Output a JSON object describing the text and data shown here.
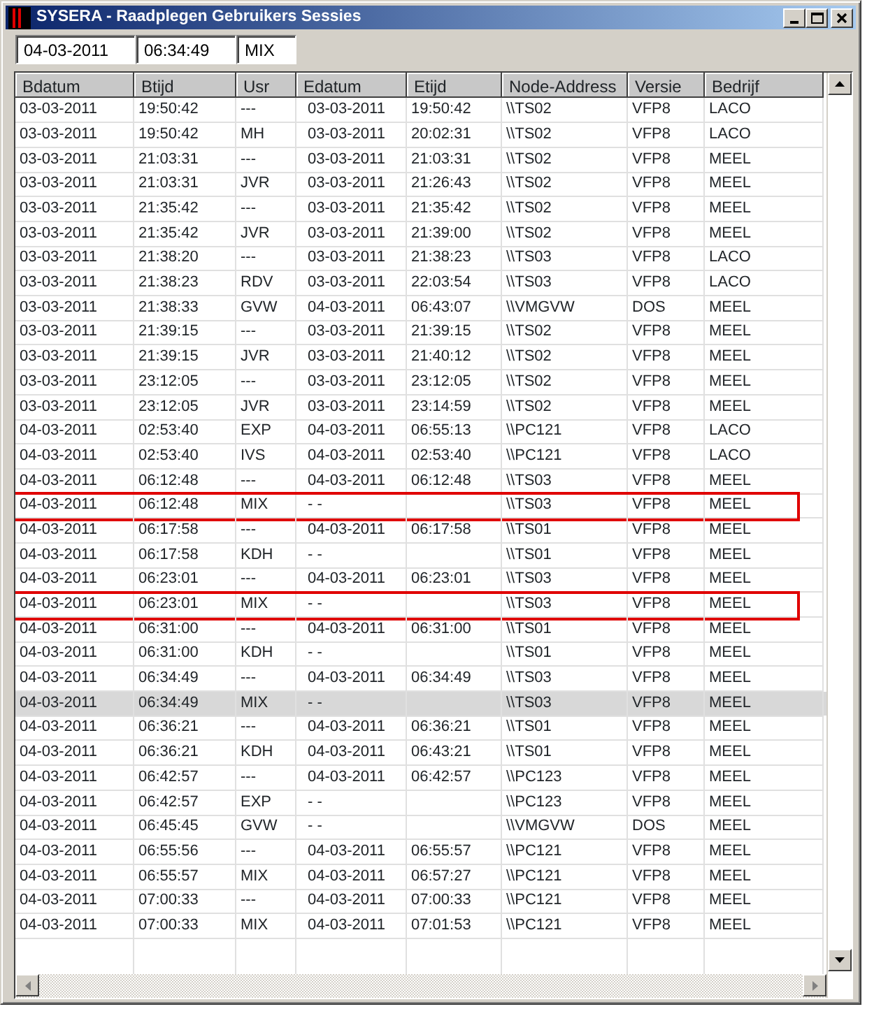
{
  "window": {
    "title": "SYSERA - Raadplegen Gebruikers Sessies"
  },
  "fields": [
    {
      "value": "04-03-2011"
    },
    {
      "value": "06:34:49"
    },
    {
      "value": "MIX"
    }
  ],
  "table": {
    "columns": [
      {
        "label": "Bdatum"
      },
      {
        "label": "Btijd"
      },
      {
        "label": "Usr"
      },
      {
        "label": "Edatum"
      },
      {
        "label": "Etijd"
      },
      {
        "label": "Node-Address"
      },
      {
        "label": "Versie"
      },
      {
        "label": "Bedrijf"
      }
    ],
    "rows": [
      {
        "bdatum": "03-03-2011",
        "btijd": "19:50:42",
        "usr": "---",
        "edatum": "03-03-2011",
        "etijd": "19:50:42",
        "node_address": "\\\\TS02",
        "versie": "VFP8",
        "bedrijf": "LACO",
        "selected": false,
        "marked": false
      },
      {
        "bdatum": "03-03-2011",
        "btijd": "19:50:42",
        "usr": "MH",
        "edatum": "03-03-2011",
        "etijd": "20:02:31",
        "node_address": "\\\\TS02",
        "versie": "VFP8",
        "bedrijf": "LACO",
        "selected": false,
        "marked": false
      },
      {
        "bdatum": "03-03-2011",
        "btijd": "21:03:31",
        "usr": "---",
        "edatum": "03-03-2011",
        "etijd": "21:03:31",
        "node_address": "\\\\TS02",
        "versie": "VFP8",
        "bedrijf": "MEEL",
        "selected": false,
        "marked": false
      },
      {
        "bdatum": "03-03-2011",
        "btijd": "21:03:31",
        "usr": "JVR",
        "edatum": "03-03-2011",
        "etijd": "21:26:43",
        "node_address": "\\\\TS02",
        "versie": "VFP8",
        "bedrijf": "MEEL",
        "selected": false,
        "marked": false
      },
      {
        "bdatum": "03-03-2011",
        "btijd": "21:35:42",
        "usr": "---",
        "edatum": "03-03-2011",
        "etijd": "21:35:42",
        "node_address": "\\\\TS02",
        "versie": "VFP8",
        "bedrijf": "MEEL",
        "selected": false,
        "marked": false
      },
      {
        "bdatum": "03-03-2011",
        "btijd": "21:35:42",
        "usr": "JVR",
        "edatum": "03-03-2011",
        "etijd": "21:39:00",
        "node_address": "\\\\TS02",
        "versie": "VFP8",
        "bedrijf": "MEEL",
        "selected": false,
        "marked": false
      },
      {
        "bdatum": "03-03-2011",
        "btijd": "21:38:20",
        "usr": "---",
        "edatum": "03-03-2011",
        "etijd": "21:38:23",
        "node_address": "\\\\TS03",
        "versie": "VFP8",
        "bedrijf": "LACO",
        "selected": false,
        "marked": false
      },
      {
        "bdatum": "03-03-2011",
        "btijd": "21:38:23",
        "usr": "RDV",
        "edatum": "03-03-2011",
        "etijd": "22:03:54",
        "node_address": "\\\\TS03",
        "versie": "VFP8",
        "bedrijf": "LACO",
        "selected": false,
        "marked": false
      },
      {
        "bdatum": "03-03-2011",
        "btijd": "21:38:33",
        "usr": "GVW",
        "edatum": "04-03-2011",
        "etijd": "06:43:07",
        "node_address": "\\\\VMGVW",
        "versie": "DOS",
        "bedrijf": "MEEL",
        "selected": false,
        "marked": false
      },
      {
        "bdatum": "03-03-2011",
        "btijd": "21:39:15",
        "usr": "---",
        "edatum": "03-03-2011",
        "etijd": "21:39:15",
        "node_address": "\\\\TS02",
        "versie": "VFP8",
        "bedrijf": "MEEL",
        "selected": false,
        "marked": false
      },
      {
        "bdatum": "03-03-2011",
        "btijd": "21:39:15",
        "usr": "JVR",
        "edatum": "03-03-2011",
        "etijd": "21:40:12",
        "node_address": "\\\\TS02",
        "versie": "VFP8",
        "bedrijf": "MEEL",
        "selected": false,
        "marked": false
      },
      {
        "bdatum": "03-03-2011",
        "btijd": "23:12:05",
        "usr": "---",
        "edatum": "03-03-2011",
        "etijd": "23:12:05",
        "node_address": "\\\\TS02",
        "versie": "VFP8",
        "bedrijf": "MEEL",
        "selected": false,
        "marked": false
      },
      {
        "bdatum": "03-03-2011",
        "btijd": "23:12:05",
        "usr": "JVR",
        "edatum": "03-03-2011",
        "etijd": "23:14:59",
        "node_address": "\\\\TS02",
        "versie": "VFP8",
        "bedrijf": "MEEL",
        "selected": false,
        "marked": false
      },
      {
        "bdatum": "04-03-2011",
        "btijd": "02:53:40",
        "usr": "EXP",
        "edatum": "04-03-2011",
        "etijd": "06:55:13",
        "node_address": "\\\\PC121",
        "versie": "VFP8",
        "bedrijf": "LACO",
        "selected": false,
        "marked": false
      },
      {
        "bdatum": "04-03-2011",
        "btijd": "02:53:40",
        "usr": "IVS",
        "edatum": "04-03-2011",
        "etijd": "02:53:40",
        "node_address": "\\\\PC121",
        "versie": "VFP8",
        "bedrijf": "LACO",
        "selected": false,
        "marked": false
      },
      {
        "bdatum": "04-03-2011",
        "btijd": "06:12:48",
        "usr": "---",
        "edatum": "04-03-2011",
        "etijd": "06:12:48",
        "node_address": "\\\\TS03",
        "versie": "VFP8",
        "bedrijf": "MEEL",
        "selected": false,
        "marked": false
      },
      {
        "bdatum": "04-03-2011",
        "btijd": "06:12:48",
        "usr": "MIX",
        "edatum": "- -",
        "node_address": "\\\\TS03",
        "versie": "VFP8",
        "bedrijf": "MEEL",
        "selected": false,
        "marked": true
      },
      {
        "bdatum": "04-03-2011",
        "btijd": "06:17:58",
        "usr": "---",
        "edatum": "04-03-2011",
        "etijd": "06:17:58",
        "node_address": "\\\\TS01",
        "versie": "VFP8",
        "bedrijf": "MEEL",
        "selected": false,
        "marked": false
      },
      {
        "bdatum": "04-03-2011",
        "btijd": "06:17:58",
        "usr": "KDH",
        "edatum": "- -",
        "node_address": "\\\\TS01",
        "versie": "VFP8",
        "bedrijf": "MEEL",
        "selected": false,
        "marked": false
      },
      {
        "bdatum": "04-03-2011",
        "btijd": "06:23:01",
        "usr": "---",
        "edatum": "04-03-2011",
        "etijd": "06:23:01",
        "node_address": "\\\\TS03",
        "versie": "VFP8",
        "bedrijf": "MEEL",
        "selected": false,
        "marked": false
      },
      {
        "bdatum": "04-03-2011",
        "btijd": "06:23:01",
        "usr": "MIX",
        "edatum": "- -",
        "node_address": "\\\\TS03",
        "versie": "VFP8",
        "bedrijf": "MEEL",
        "selected": false,
        "marked": true
      },
      {
        "bdatum": "04-03-2011",
        "btijd": "06:31:00",
        "usr": "---",
        "edatum": "04-03-2011",
        "etijd": "06:31:00",
        "node_address": "\\\\TS01",
        "versie": "VFP8",
        "bedrijf": "MEEL",
        "selected": false,
        "marked": false
      },
      {
        "bdatum": "04-03-2011",
        "btijd": "06:31:00",
        "usr": "KDH",
        "edatum": "- -",
        "node_address": "\\\\TS01",
        "versie": "VFP8",
        "bedrijf": "MEEL",
        "selected": false,
        "marked": false
      },
      {
        "bdatum": "04-03-2011",
        "btijd": "06:34:49",
        "usr": "---",
        "edatum": "04-03-2011",
        "etijd": "06:34:49",
        "node_address": "\\\\TS03",
        "versie": "VFP8",
        "bedrijf": "MEEL",
        "selected": false,
        "marked": false
      },
      {
        "bdatum": "04-03-2011",
        "btijd": "06:34:49",
        "usr": "MIX",
        "edatum": "- -",
        "node_address": "\\\\TS03",
        "versie": "VFP8",
        "bedrijf": "MEEL",
        "selected": true,
        "marked": false
      },
      {
        "bdatum": "04-03-2011",
        "btijd": "06:36:21",
        "usr": "---",
        "edatum": "04-03-2011",
        "etijd": "06:36:21",
        "node_address": "\\\\TS01",
        "versie": "VFP8",
        "bedrijf": "MEEL",
        "selected": false,
        "marked": false
      },
      {
        "bdatum": "04-03-2011",
        "btijd": "06:36:21",
        "usr": "KDH",
        "edatum": "04-03-2011",
        "etijd": "06:43:21",
        "node_address": "\\\\TS01",
        "versie": "VFP8",
        "bedrijf": "MEEL",
        "selected": false,
        "marked": false
      },
      {
        "bdatum": "04-03-2011",
        "btijd": "06:42:57",
        "usr": "---",
        "edatum": "04-03-2011",
        "etijd": "06:42:57",
        "node_address": "\\\\PC123",
        "versie": "VFP8",
        "bedrijf": "MEEL",
        "selected": false,
        "marked": false
      },
      {
        "bdatum": "04-03-2011",
        "btijd": "06:42:57",
        "usr": "EXP",
        "edatum": "- -",
        "node_address": "\\\\PC123",
        "versie": "VFP8",
        "bedrijf": "MEEL",
        "selected": false,
        "marked": false
      },
      {
        "bdatum": "04-03-2011",
        "btijd": "06:45:45",
        "usr": "GVW",
        "edatum": "- -",
        "node_address": "\\\\VMGVW",
        "versie": "DOS",
        "bedrijf": "MEEL",
        "selected": false,
        "marked": false
      },
      {
        "bdatum": "04-03-2011",
        "btijd": "06:55:56",
        "usr": "---",
        "edatum": "04-03-2011",
        "etijd": "06:55:57",
        "node_address": "\\\\PC121",
        "versie": "VFP8",
        "bedrijf": "MEEL",
        "selected": false,
        "marked": false
      },
      {
        "bdatum": "04-03-2011",
        "btijd": "06:55:57",
        "usr": "MIX",
        "edatum": "04-03-2011",
        "etijd": "06:57:27",
        "node_address": "\\\\PC121",
        "versie": "VFP8",
        "bedrijf": "MEEL",
        "selected": false,
        "marked": false
      },
      {
        "bdatum": "04-03-2011",
        "btijd": "07:00:33",
        "usr": "---",
        "edatum": "04-03-2011",
        "etijd": "07:00:33",
        "node_address": "\\\\PC121",
        "versie": "VFP8",
        "bedrijf": "MEEL",
        "selected": false,
        "marked": false
      },
      {
        "bdatum": "04-03-2011",
        "btijd": "07:00:33",
        "usr": "MIX",
        "edatum": "04-03-2011",
        "etijd": "07:01:53",
        "node_address": "\\\\PC121",
        "versie": "VFP8",
        "bedrijf": "MEEL",
        "selected": false,
        "marked": false
      }
    ]
  }
}
